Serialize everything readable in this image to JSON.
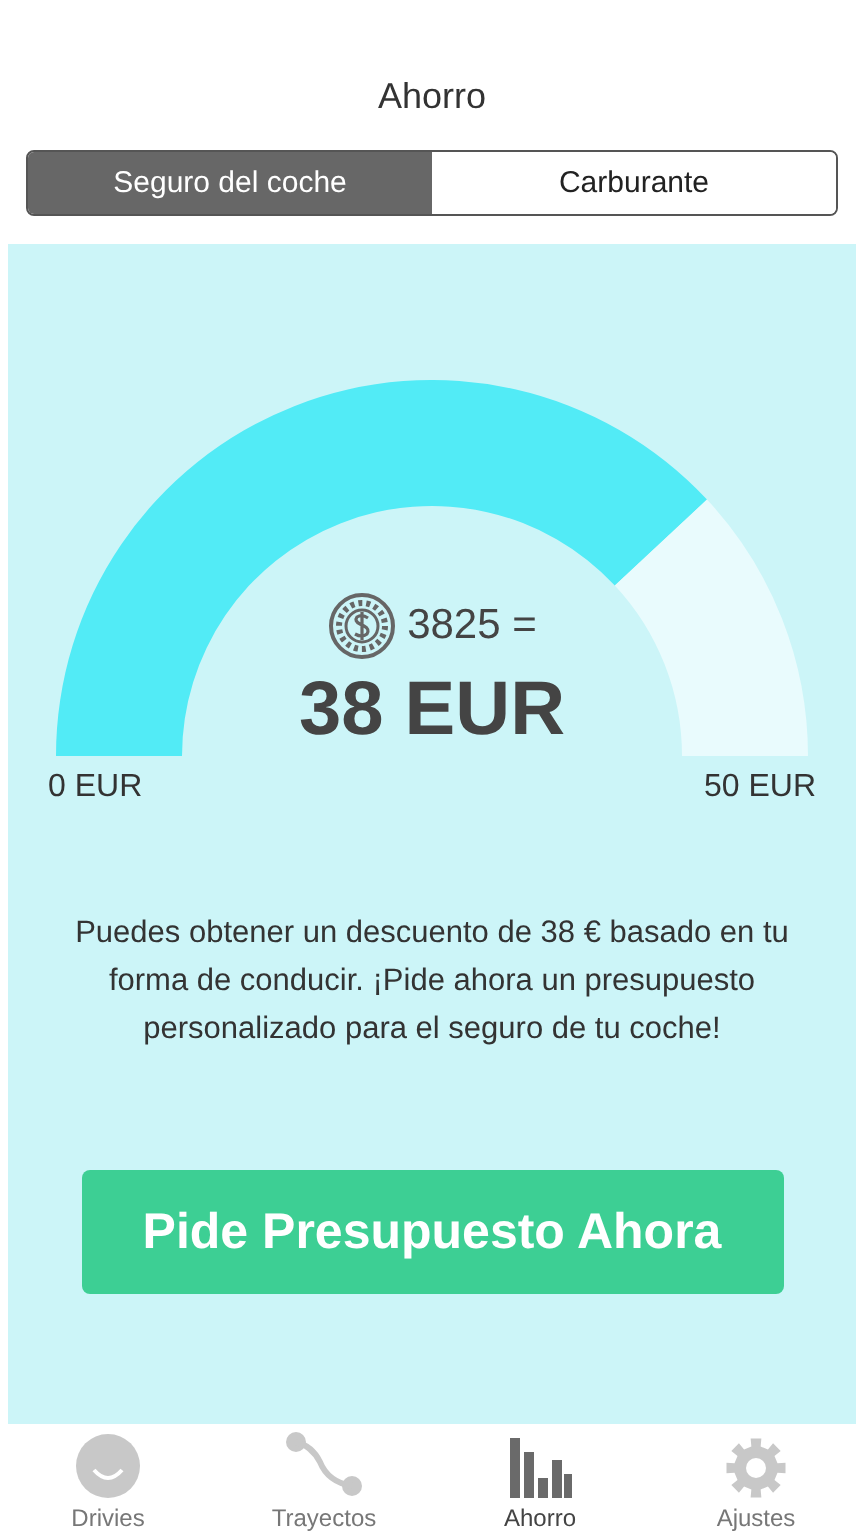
{
  "header": {
    "title": "Ahorro"
  },
  "segments": [
    {
      "label": "Seguro del coche",
      "selected": true
    },
    {
      "label": "Carburante",
      "selected": false
    }
  ],
  "gauge": {
    "points": "3825 =",
    "amount": "38 EUR",
    "min_label": "0 EUR",
    "max_label": "50 EUR"
  },
  "message": "Puedes obtener un descuento de 38 € basado en tu forma de conducir. ¡Pide ahora un presupuesto personalizado para el seguro de tu coche!",
  "cta": "Pide Presupuesto Ahora",
  "tab_bar": [
    {
      "label": "Drivies",
      "kind": "smiley",
      "selected": false
    },
    {
      "label": "Trayectos",
      "kind": "route",
      "selected": false
    },
    {
      "label": "Ahorro",
      "kind": "bars",
      "selected": true
    },
    {
      "label": "Ajustes",
      "kind": "gear",
      "selected": false
    }
  ]
}
